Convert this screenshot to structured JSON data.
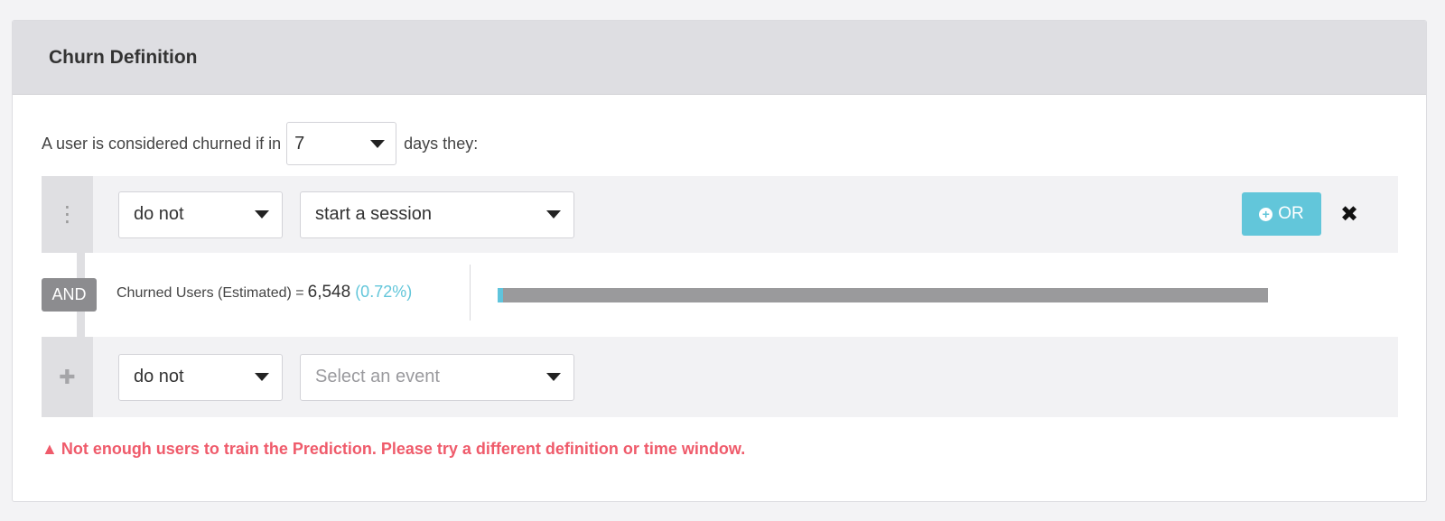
{
  "panel": {
    "title": "Churn Definition"
  },
  "definition": {
    "sentence_prefix": "A user is considered churned if in",
    "days_value": "7",
    "sentence_suffix": "days they:"
  },
  "filters": [
    {
      "negation": "do not",
      "event": "start a session",
      "or_label": "OR"
    },
    {
      "negation": "do not",
      "event_placeholder": "Select an event"
    }
  ],
  "connector_label": "AND",
  "estimate": {
    "label": "Churned Users (Estimated) =",
    "count": "6,548",
    "percent": "(0.72%)",
    "fraction": 0.0072
  },
  "warning": {
    "icon": "warning-triangle-icon",
    "text": "Not enough users to train the Prediction. Please try a different definition or time window."
  },
  "colors": {
    "accent": "#62c6da",
    "error": "#ef5b6b"
  }
}
